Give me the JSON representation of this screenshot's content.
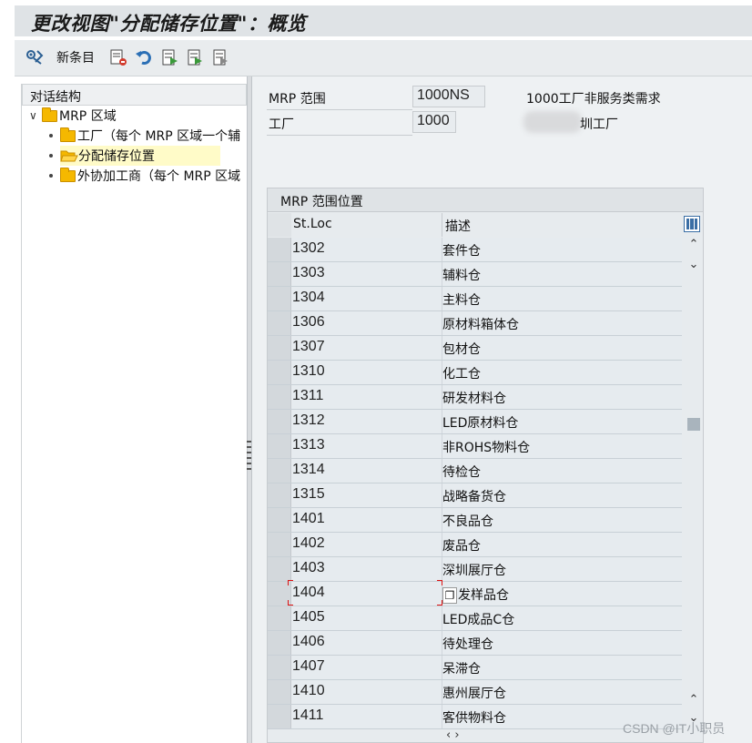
{
  "window": {
    "title": "更改视图\"分配储存位置\"：概览"
  },
  "toolbar": {
    "new_entries_label": "新条目"
  },
  "dialog_structure": {
    "header": "对话结构",
    "root": {
      "label": "MRP 区域",
      "expanded": true
    },
    "children": [
      {
        "label": "工厂（每个 MRP 区域一个辅",
        "selected": false
      },
      {
        "label": "分配储存位置",
        "selected": true
      },
      {
        "label": "外协加工商（每个 MRP 区域",
        "selected": false
      }
    ]
  },
  "header_fields": {
    "mrp_area_label": "MRP 范围",
    "mrp_area_value": "1000NS",
    "mrp_area_text": "1000工厂非服务类需求",
    "plant_label": "工厂",
    "plant_value": "1000",
    "plant_text": "圳工厂"
  },
  "table": {
    "title": "MRP 范围位置",
    "columns": [
      "St.Loc",
      "描述"
    ],
    "rows": [
      {
        "sloc": "1302",
        "desc": "套件仓"
      },
      {
        "sloc": "1303",
        "desc": "辅料仓"
      },
      {
        "sloc": "1304",
        "desc": "主料仓"
      },
      {
        "sloc": "1306",
        "desc": "原材料箱体仓"
      },
      {
        "sloc": "1307",
        "desc": "包材仓"
      },
      {
        "sloc": "1310",
        "desc": "化工仓"
      },
      {
        "sloc": "1311",
        "desc": "研发材料仓"
      },
      {
        "sloc": "1312",
        "desc": "LED原材料仓"
      },
      {
        "sloc": "1313",
        "desc": "非ROHS物料仓"
      },
      {
        "sloc": "1314",
        "desc": "待检仓"
      },
      {
        "sloc": "1315",
        "desc": "战略备货仓"
      },
      {
        "sloc": "1401",
        "desc": "不良品仓"
      },
      {
        "sloc": "1402",
        "desc": "废品仓"
      },
      {
        "sloc": "1403",
        "desc": "深圳展厅仓"
      },
      {
        "sloc": "1404",
        "desc": "发样品仓"
      },
      {
        "sloc": "1405",
        "desc": "LED成品C仓"
      },
      {
        "sloc": "1406",
        "desc": "待处理仓"
      },
      {
        "sloc": "1407",
        "desc": "呆滞仓"
      },
      {
        "sloc": "1410",
        "desc": "惠州展厅仓"
      },
      {
        "sloc": "1411",
        "desc": "客供物料仓"
      }
    ]
  },
  "watermark": "CSDN @IT小职员",
  "colors": {
    "accent": "#3a6ea5",
    "folder": "#f5b800",
    "selected_bg": "#fffbc8"
  }
}
